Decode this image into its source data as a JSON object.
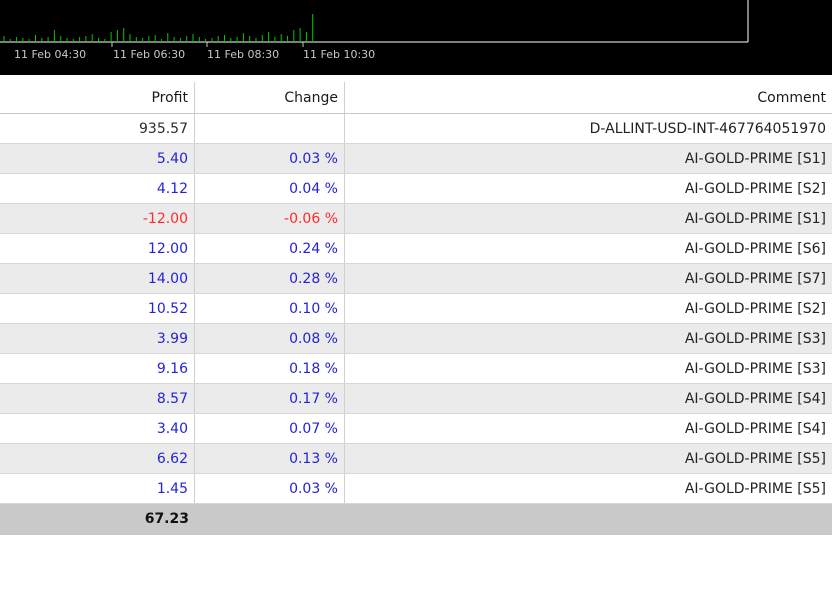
{
  "chart": {
    "time_labels": [
      "11 Feb 04:30",
      "11 Feb 06:30",
      "11 Feb 08:30",
      "11 Feb 10:30"
    ],
    "volume_bar_color": "#00c800",
    "frame_color": "#ffffff"
  },
  "table": {
    "headers": {
      "profit": "Profit",
      "change": "Change",
      "comment": "Comment"
    },
    "rows": [
      {
        "profit": "935.57",
        "change": "",
        "comment": "D-ALLINT-USD-INT-467764051970",
        "tone": "dark"
      },
      {
        "profit": "5.40",
        "change": "0.03 %",
        "comment": "AI-GOLD-PRIME [S1]",
        "tone": "blue"
      },
      {
        "profit": "4.12",
        "change": "0.04 %",
        "comment": "AI-GOLD-PRIME [S2]",
        "tone": "blue"
      },
      {
        "profit": "-12.00",
        "change": "-0.06 %",
        "comment": "AI-GOLD-PRIME [S1]",
        "tone": "red"
      },
      {
        "profit": "12.00",
        "change": "0.24 %",
        "comment": "AI-GOLD-PRIME [S6]",
        "tone": "blue"
      },
      {
        "profit": "14.00",
        "change": "0.28 %",
        "comment": "AI-GOLD-PRIME [S7]",
        "tone": "blue"
      },
      {
        "profit": "10.52",
        "change": "0.10 %",
        "comment": "AI-GOLD-PRIME [S2]",
        "tone": "blue"
      },
      {
        "profit": "3.99",
        "change": "0.08 %",
        "comment": "AI-GOLD-PRIME [S3]",
        "tone": "blue"
      },
      {
        "profit": "9.16",
        "change": "0.18 %",
        "comment": "AI-GOLD-PRIME [S3]",
        "tone": "blue"
      },
      {
        "profit": "8.57",
        "change": "0.17 %",
        "comment": "AI-GOLD-PRIME [S4]",
        "tone": "blue"
      },
      {
        "profit": "3.40",
        "change": "0.07 %",
        "comment": "AI-GOLD-PRIME [S4]",
        "tone": "blue"
      },
      {
        "profit": "6.62",
        "change": "0.13 %",
        "comment": "AI-GOLD-PRIME [S5]",
        "tone": "blue"
      },
      {
        "profit": "1.45",
        "change": "0.03 %",
        "comment": "AI-GOLD-PRIME [S5]",
        "tone": "blue"
      }
    ],
    "total_profit": "67.23"
  },
  "colors": {
    "positive": "#2424d6",
    "negative": "#ff2a2a",
    "summary_bg": "#c9c9c9"
  }
}
